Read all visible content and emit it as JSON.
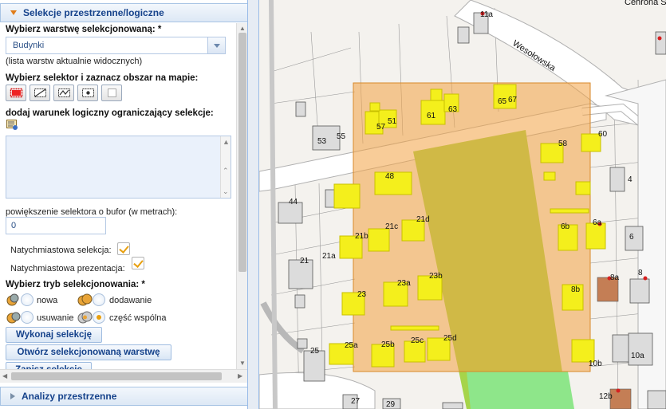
{
  "panel": {
    "top_header": "Selekcje przestrzenne/logiczne",
    "bottom_header": "Analizy przestrzenne",
    "layer_label": "Wybierz warstwę selekcjonowaną: *",
    "layer_value": "Budynki",
    "layer_hint": "(lista warstw aktualnie widocznych)",
    "selector_label": "Wybierz selektor i zaznacz obszar na mapie:",
    "condition_label": "dodaj warunek logiczny ograniczający selekcje:",
    "buffer_label": "powiększenie selektora o bufor (w metrach):",
    "buffer_value": "0",
    "instant_selection": "Natychmiastowa selekcja:",
    "instant_presentation": "Natychmiastowa prezentacja:",
    "mode_label": "Wybierz tryb selekcjonowania: *",
    "modes": {
      "new": "nowa",
      "add": "dodawanie",
      "remove": "usuwanie",
      "intersect": "część wspólna"
    },
    "buttons": {
      "execute": "Wykonaj selekcję",
      "open_layer": "Otwórz selekcjonowaną warstwę",
      "save": "Zapisz selekcję"
    }
  },
  "map": {
    "street": "Wesołowska",
    "corner_text": "Cehrona Srod",
    "labels": {
      "l11a": "11a",
      "l53": "53",
      "l55": "55",
      "l57": "57",
      "l51": "51",
      "l61": "61",
      "l63": "63",
      "l65": "65",
      "l67": "67",
      "l60": "60",
      "l58": "58",
      "l4": "4",
      "l44": "44",
      "l48": "48",
      "l21": "21",
      "l21a": "21a",
      "l21b": "21b",
      "l21c": "21c",
      "l21d": "21d",
      "l6a": "6a",
      "l6b": "6b",
      "l6": "6",
      "l23": "23",
      "l23a": "23a",
      "l23b": "23b",
      "l8": "8",
      "l8a": "8a",
      "l8b": "8b",
      "l25": "25",
      "l25a": "25a",
      "l25b": "25b",
      "l25c": "25c",
      "l25d": "25d",
      "l10a": "10a",
      "l10b": "10b",
      "l27": "27",
      "l29": "29",
      "l12b": "12b"
    }
  }
}
